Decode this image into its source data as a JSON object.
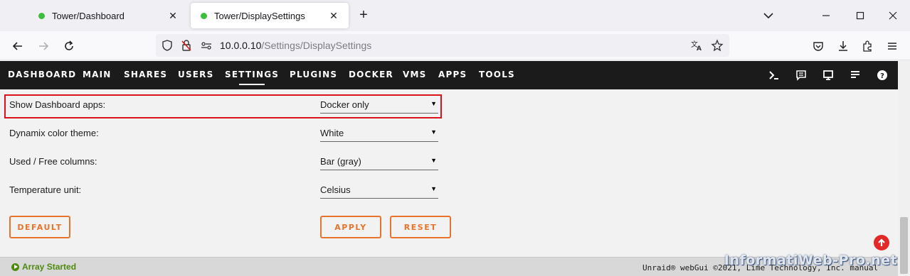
{
  "browser": {
    "tabs": [
      {
        "title": "Tower/Dashboard",
        "active": false
      },
      {
        "title": "Tower/DisplaySettings",
        "active": true
      }
    ],
    "new_tab_symbol": "+",
    "close_symbol": "✕",
    "url_host": "10.0.0.10",
    "url_path": "/Settings/DisplaySettings"
  },
  "menu": {
    "items": [
      "DASHBOARD",
      "MAIN",
      "SHARES",
      "USERS",
      "SETTINGS",
      "PLUGINS",
      "DOCKER",
      "VMS",
      "APPS",
      "TOOLS"
    ],
    "active": "SETTINGS",
    "icons": [
      "terminal-icon",
      "log-icon",
      "monitor-icon",
      "feedback-icon",
      "help-icon"
    ]
  },
  "settings": {
    "rows": [
      {
        "label": "Show Dashboard apps:",
        "value": "Docker only"
      },
      {
        "label": "Dynamix color theme:",
        "value": "White"
      },
      {
        "label": "Used / Free columns:",
        "value": "Bar (gray)"
      },
      {
        "label": "Temperature unit:",
        "value": "Celsius"
      }
    ],
    "buttons": {
      "default": "DEFAULT",
      "apply": "APPLY",
      "reset": "RESET"
    }
  },
  "footer": {
    "status": "Array Started",
    "copyright": "Unraid® webGui ©2021, Lime Technology, Inc. manual"
  },
  "watermark": "InformatiWeb-Pro.net",
  "colors": {
    "accent": "#e8742c",
    "menu_bg": "#1c1b1b",
    "highlight": "#d8141a",
    "status_green": "#4f8a10"
  }
}
